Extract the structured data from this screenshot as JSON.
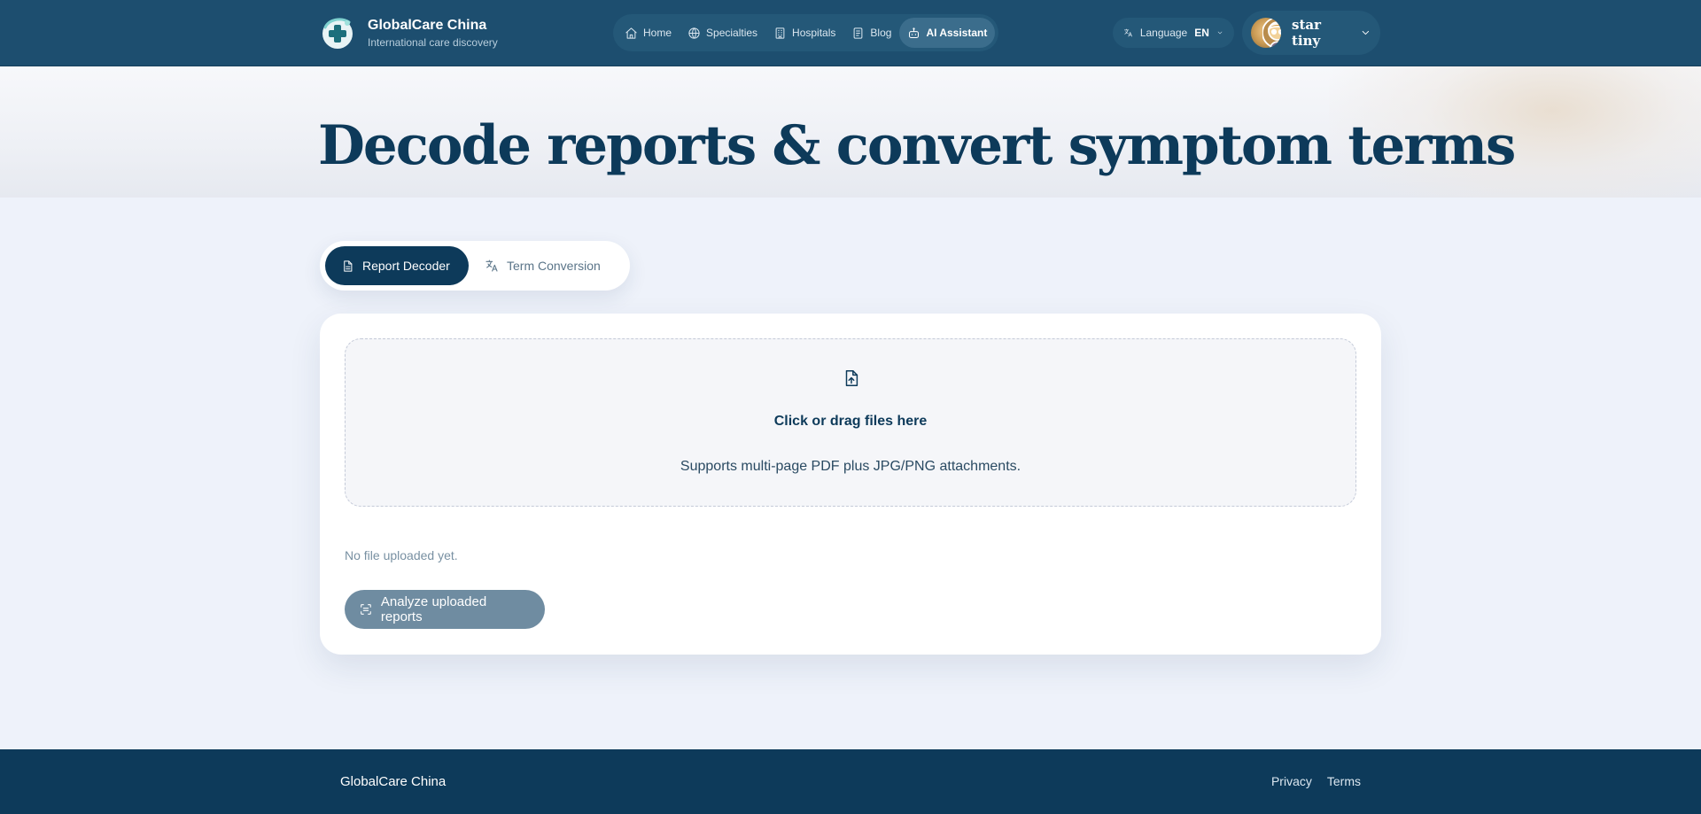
{
  "brand": {
    "title": "GlobalCare China",
    "subtitle": "International care discovery"
  },
  "nav": {
    "items": [
      {
        "label": "Home",
        "icon": "home-icon"
      },
      {
        "label": "Specialties",
        "icon": "globe-icon"
      },
      {
        "label": "Hospitals",
        "icon": "building-icon"
      },
      {
        "label": "Blog",
        "icon": "book-icon"
      },
      {
        "label": "AI Assistant",
        "icon": "bot-icon",
        "active": true
      }
    ]
  },
  "language": {
    "label": "Language",
    "code": "EN"
  },
  "user": {
    "name": "star tiny"
  },
  "hero": {
    "title": "Decode reports & convert symptom terms"
  },
  "tabs": [
    {
      "label": "Report Decoder",
      "icon": "document-icon",
      "active": true
    },
    {
      "label": "Term Conversion",
      "icon": "translate-icon",
      "active": false
    }
  ],
  "upload": {
    "title": "Click or drag files here",
    "subtitle": "Supports multi-page PDF plus JPG/PNG attachments."
  },
  "status": {
    "no_file": "No file uploaded yet."
  },
  "actions": {
    "analyze_label": "Analyze uploaded reports"
  },
  "footer": {
    "brand": "GlobalCare China",
    "links": [
      "Privacy",
      "Terms"
    ]
  },
  "colors": {
    "header_bg": "#1d4e6f",
    "primary": "#0d3a5a",
    "disabled_button": "#6f8ca1",
    "page_bg": "#eef2fa"
  }
}
